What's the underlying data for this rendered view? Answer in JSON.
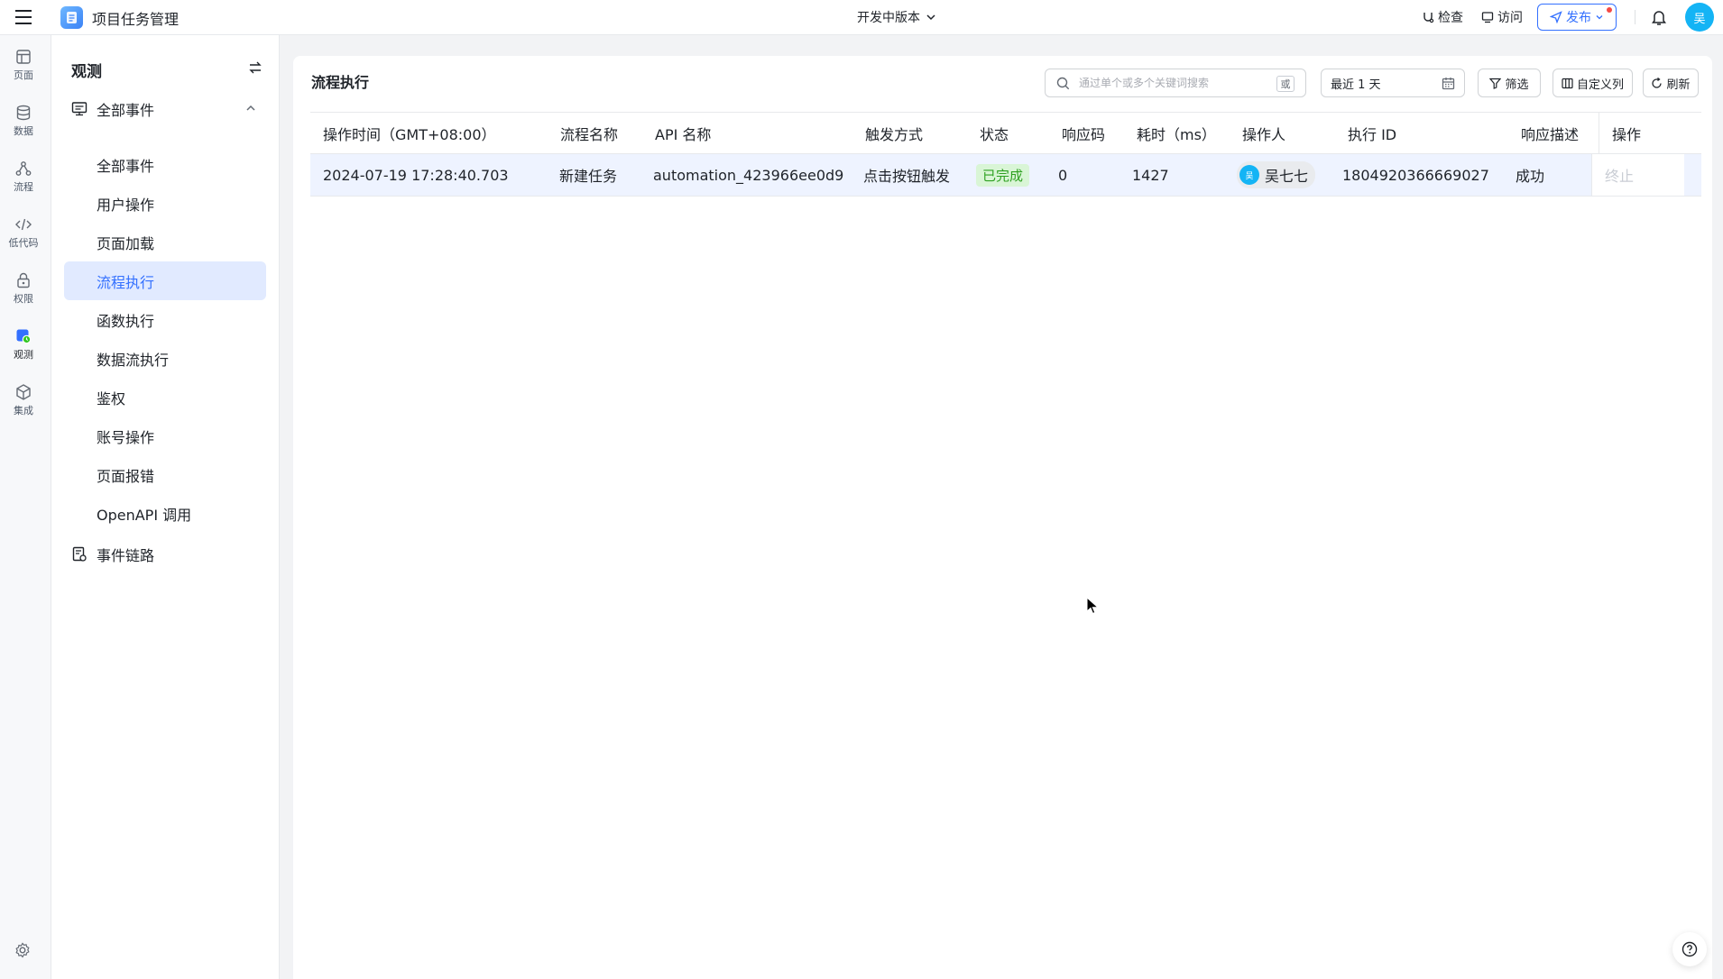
{
  "app": {
    "title": "项目任务管理",
    "avatar_initial": "吴"
  },
  "header": {
    "version_label": "开发中版本",
    "check_label": "检查",
    "visit_label": "访问",
    "publish_label": "发布"
  },
  "rail": {
    "items": [
      {
        "label": "页面",
        "icon": "page-icon"
      },
      {
        "label": "数据",
        "icon": "database-icon"
      },
      {
        "label": "流程",
        "icon": "flow-icon"
      },
      {
        "label": "低代码",
        "icon": "code-icon"
      },
      {
        "label": "权限",
        "icon": "lock-icon"
      },
      {
        "label": "观测",
        "icon": "monitor-icon",
        "active": true
      },
      {
        "label": "集成",
        "icon": "cube-icon"
      }
    ]
  },
  "sidebar": {
    "title": "观测",
    "group_label": "全部事件",
    "items": [
      {
        "label": "全部事件"
      },
      {
        "label": "用户操作"
      },
      {
        "label": "页面加载"
      },
      {
        "label": "流程执行",
        "active": true
      },
      {
        "label": "函数执行"
      },
      {
        "label": "数据流执行"
      },
      {
        "label": "鉴权"
      },
      {
        "label": "账号操作"
      },
      {
        "label": "页面报错"
      },
      {
        "label": "OpenAPI 调用"
      }
    ],
    "chain_label": "事件链路"
  },
  "main": {
    "title": "流程执行",
    "search_placeholder": "通过单个或多个关键词搜索",
    "or_label": "或",
    "date_range": "最近 1 天",
    "filter_label": "筛选",
    "custom_columns_label": "自定义列",
    "refresh_label": "刷新"
  },
  "table": {
    "columns": [
      "操作时间（GMT+08:00）",
      "流程名称",
      "API 名称",
      "触发方式",
      "状态",
      "响应码",
      "耗时（ms）",
      "操作人",
      "执行 ID",
      "响应描述",
      "操作"
    ],
    "rows": [
      {
        "time": "2024-07-19 17:28:40.703",
        "flow_name": "新建任务",
        "api_name": "automation_423966ee0d9",
        "trigger": "点击按钮触发",
        "status": "已完成",
        "code": "0",
        "duration": "1427",
        "operator": "吴七七",
        "operator_initial": "吴",
        "exec_id": "1804920366669027",
        "response": "成功",
        "action": "终止"
      }
    ]
  },
  "colors": {
    "accent": "#3370ff",
    "success_bg": "#d9f5d6",
    "success_text": "#2ea121",
    "avatar": "#14b4f5"
  }
}
